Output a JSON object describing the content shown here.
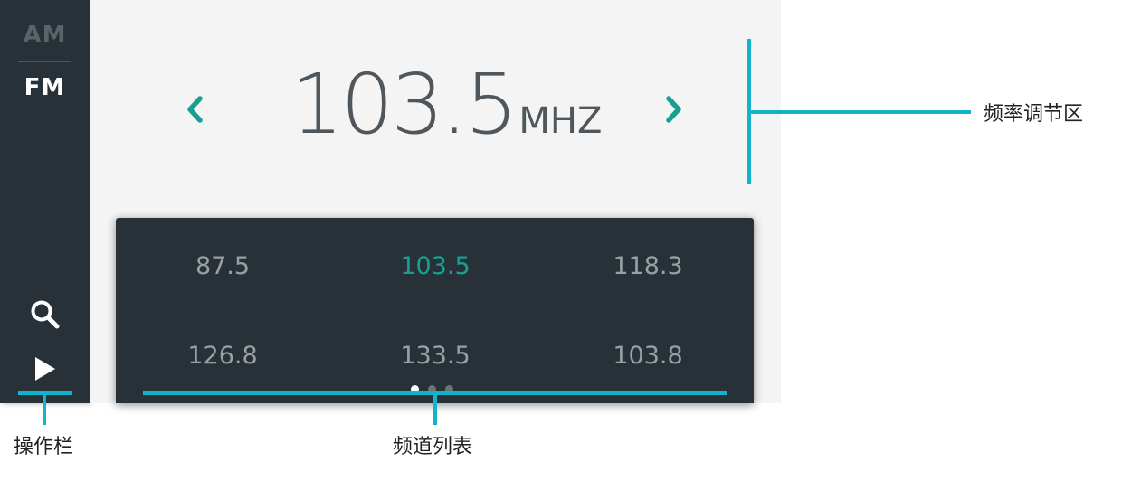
{
  "sidebar": {
    "band_am": "AM",
    "band_fm": "FM",
    "selected_band": "FM",
    "icons": [
      "search-icon",
      "play-icon"
    ]
  },
  "tuner": {
    "frequency": "103.5",
    "unit": "MHZ",
    "prev_icon": "chevron-left-icon",
    "next_icon": "chevron-right-icon",
    "accent_color": "#17a091"
  },
  "channels": {
    "items": [
      {
        "label": "87.5",
        "active": false
      },
      {
        "label": "103.5",
        "active": true
      },
      {
        "label": "118.3",
        "active": false
      },
      {
        "label": "126.8",
        "active": false
      },
      {
        "label": "133.5",
        "active": false
      },
      {
        "label": "103.8",
        "active": false
      }
    ],
    "page_count": 3,
    "current_page": 1
  },
  "annotations": {
    "frequency_area": "频率调节区",
    "toolbar": "操作栏",
    "channel_list": "频道列表",
    "line_color": "#10b4cc"
  }
}
